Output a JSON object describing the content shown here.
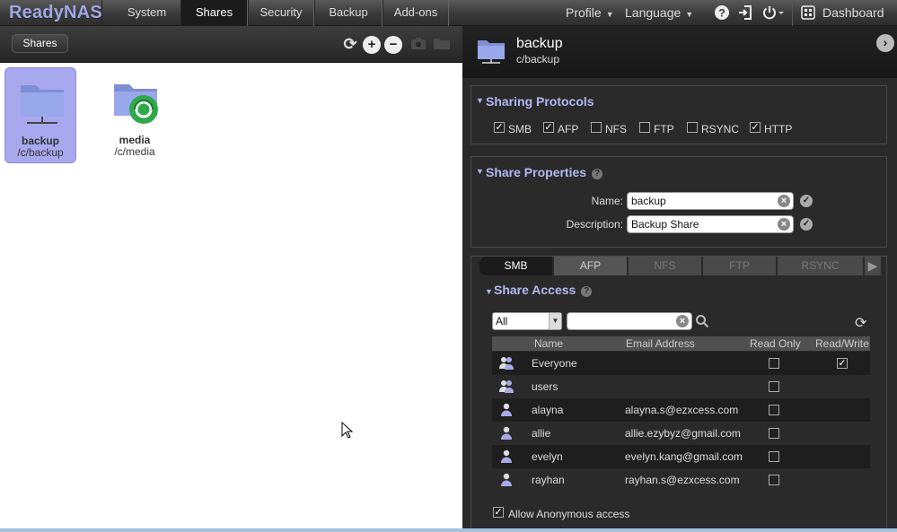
{
  "app": {
    "logo": "ReadyNAS"
  },
  "nav": {
    "tabs": [
      {
        "label": "System"
      },
      {
        "label": "Shares"
      },
      {
        "label": "Security"
      },
      {
        "label": "Backup"
      },
      {
        "label": "Add-ons"
      }
    ],
    "active_tab": "Shares",
    "profile_label": "Profile",
    "language_label": "Language",
    "dashboard_label": "Dashboard"
  },
  "left": {
    "shares_button": "Shares",
    "shares": [
      {
        "name": "backup",
        "path": "/c/backup",
        "selected": true
      },
      {
        "name": "media",
        "path": "/c/media",
        "selected": false
      }
    ]
  },
  "detail": {
    "title": "backup",
    "path": "c/backup",
    "sharing_protocols": {
      "title": "Sharing Protocols",
      "items": [
        {
          "label": "SMB",
          "checked": true
        },
        {
          "label": "AFP",
          "checked": true
        },
        {
          "label": "NFS",
          "checked": false
        },
        {
          "label": "FTP",
          "checked": false
        },
        {
          "label": "RSYNC",
          "checked": false
        },
        {
          "label": "HTTP",
          "checked": true
        }
      ]
    },
    "share_properties": {
      "title": "Share Properties",
      "name_label": "Name:",
      "name_value": "backup",
      "description_label": "Description:",
      "description_value": "Backup Share"
    },
    "protocol_tabs": [
      {
        "label": "SMB",
        "state": "active"
      },
      {
        "label": "AFP",
        "state": "enabled"
      },
      {
        "label": "NFS",
        "state": "disabled"
      },
      {
        "label": "FTP",
        "state": "disabled"
      },
      {
        "label": "RSYNC",
        "state": "disabled"
      }
    ],
    "share_access": {
      "title": "Share Access",
      "filter_value": "All",
      "columns": [
        "Name",
        "Email Address",
        "Read Only",
        "Read/Write"
      ],
      "rows": [
        {
          "type": "group",
          "name": "Everyone",
          "email": "",
          "read_only": false,
          "read_write": true
        },
        {
          "type": "group",
          "name": "users",
          "email": "",
          "read_only": false,
          "read_write": null
        },
        {
          "type": "user",
          "name": "alayna",
          "email": "alayna.s@ezxcess.com",
          "read_only": false,
          "read_write": null
        },
        {
          "type": "user",
          "name": "allie",
          "email": "allie.ezybyz@gmail.com",
          "read_only": false,
          "read_write": null
        },
        {
          "type": "user",
          "name": "evelyn",
          "email": "evelyn.kang@gmail.com",
          "read_only": false,
          "read_write": null
        },
        {
          "type": "user",
          "name": "rayhan",
          "email": "rayhan.s@ezxcess.com",
          "read_only": false,
          "read_write": null
        }
      ],
      "anonymous_label": "Allow Anonymous access",
      "anonymous_checked": true
    }
  },
  "colors": {
    "accent": "#b4b8f2",
    "selected_bg": "#a8a8ee",
    "panel_bg": "#2a2a2a"
  }
}
